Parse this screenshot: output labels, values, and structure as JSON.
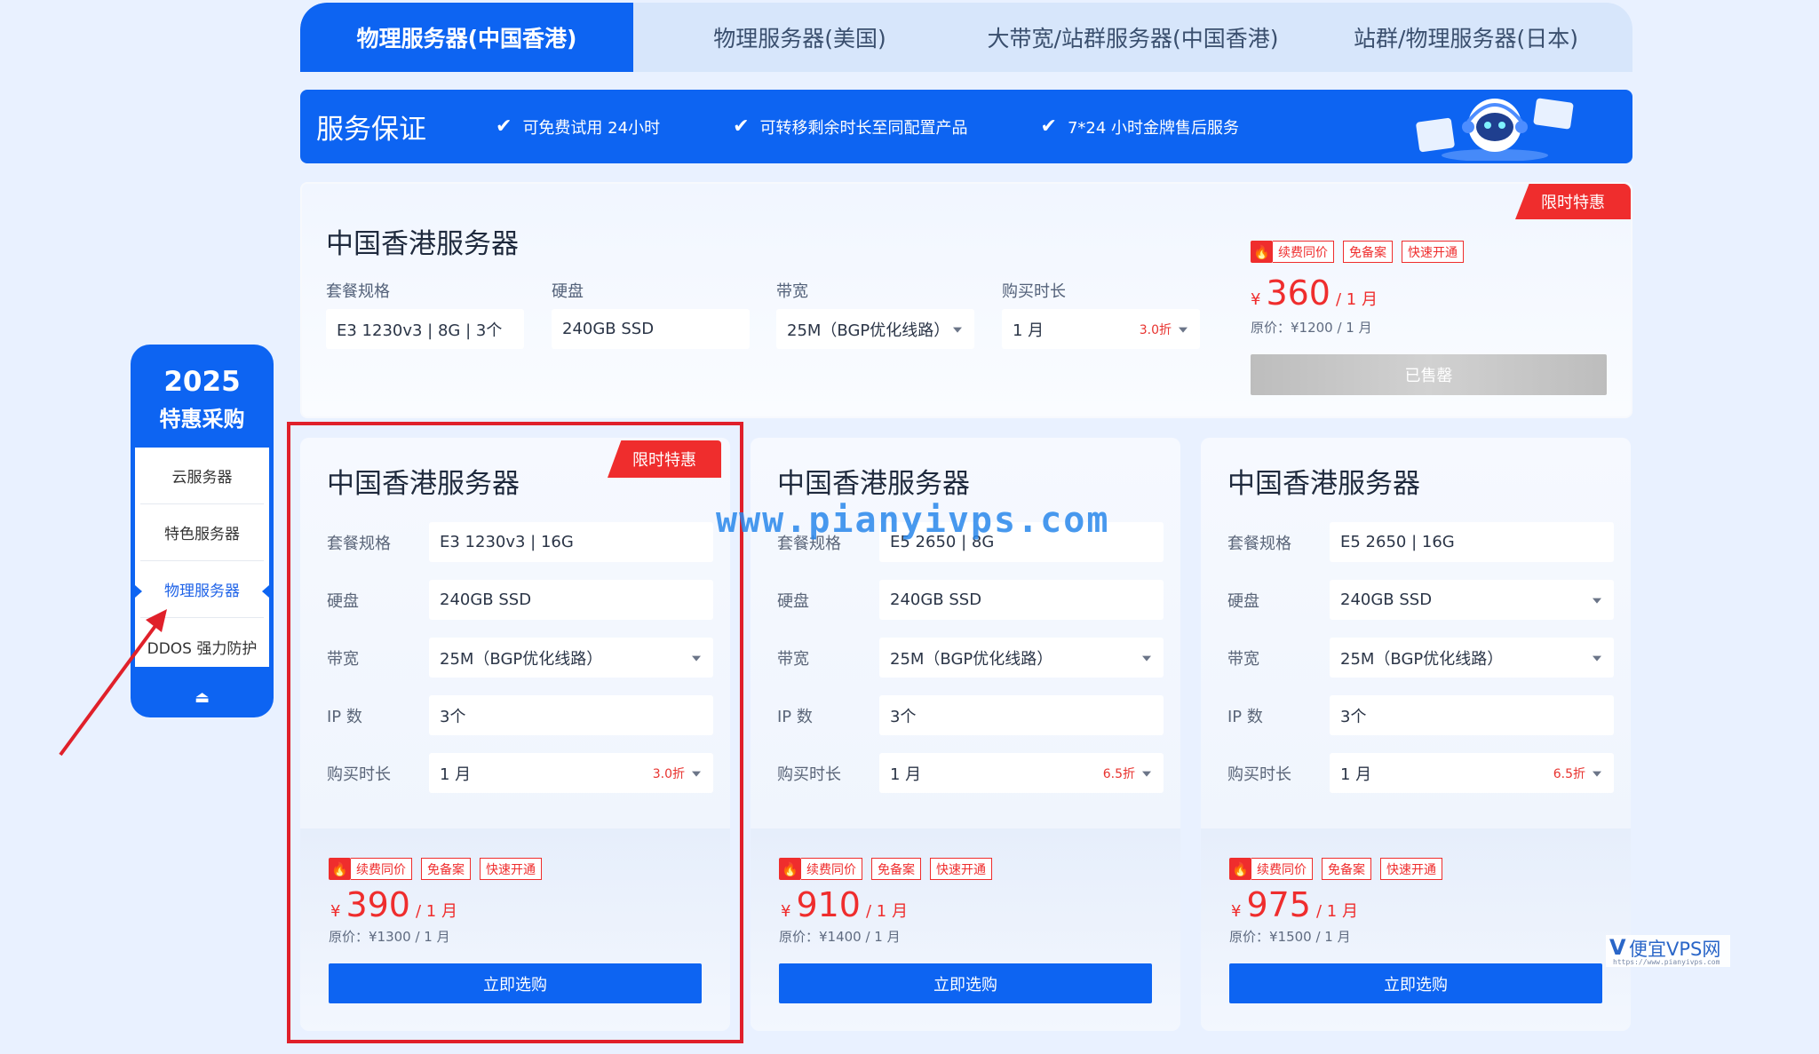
{
  "tabs": [
    {
      "label": "物理服务器(中国香港)",
      "active": true
    },
    {
      "label": "物理服务器(美国)",
      "active": false
    },
    {
      "label": "大带宽/站群服务器(中国香港)",
      "active": false
    },
    {
      "label": "站群/物理服务器(日本)",
      "active": false
    }
  ],
  "guarantee": {
    "title": "服务保证",
    "items": [
      "可免费试用 24小时",
      "可转移剩余时长至同配置产品",
      "7*24 小时金牌售后服务"
    ]
  },
  "wide_card": {
    "ribbon": "限时特惠",
    "title": "中国香港服务器",
    "fields": [
      {
        "label": "套餐规格",
        "value": "E3 1230v3 | 8G | 3个"
      },
      {
        "label": "硬盘",
        "value": "240GB SSD"
      },
      {
        "label": "带宽",
        "value": "25M（BGP优化线路）"
      },
      {
        "label": "购买时长",
        "value": "1 月",
        "discount": "3.0折"
      }
    ],
    "tags": [
      "续费同价",
      "免备案",
      "快速开通"
    ],
    "currency": "¥",
    "price": "360",
    "unit": "/ 1 月",
    "original": "原价：¥1200 / 1 月",
    "button": "已售罄"
  },
  "row_labels": {
    "spec": "套餐规格",
    "disk": "硬盘",
    "bw": "带宽",
    "ip": "IP 数",
    "dur": "购买时长"
  },
  "cards": [
    {
      "ribbon": "限时特惠",
      "title": "中国香港服务器",
      "spec": "E3 1230v3 | 16G",
      "disk": "240GB SSD",
      "bandwidth": "25M（BGP优化线路）",
      "ip": "3个",
      "duration": "1 月",
      "discount": "3.0折",
      "tags": [
        "续费同价",
        "免备案",
        "快速开通"
      ],
      "currency": "¥",
      "price": "390",
      "unit": "/ 1 月",
      "original": "原价：¥1300 / 1 月",
      "button": "立即选购"
    },
    {
      "title": "中国香港服务器",
      "spec": "E5 2650 | 8G",
      "disk": "240GB SSD",
      "bandwidth": "25M（BGP优化线路）",
      "ip": "3个",
      "duration": "1 月",
      "discount": "6.5折",
      "tags": [
        "续费同价",
        "免备案",
        "快速开通"
      ],
      "currency": "¥",
      "price": "910",
      "unit": "/ 1 月",
      "original": "原价：¥1400 / 1 月",
      "button": "立即选购"
    },
    {
      "title": "中国香港服务器",
      "spec": "E5 2650 | 16G",
      "disk": "240GB SSD",
      "bandwidth": "25M（BGP优化线路）",
      "ip": "3个",
      "duration": "1 月",
      "discount": "6.5折",
      "tags": [
        "续费同价",
        "免备案",
        "快速开通"
      ],
      "currency": "¥",
      "price": "975",
      "unit": "/ 1 月",
      "original": "原价：¥1500 / 1 月",
      "button": "立即选购"
    }
  ],
  "promo": {
    "year": "2025",
    "subtitle": "特惠采购",
    "menu": [
      "云服务器",
      "特色服务器",
      "物理服务器",
      "DDOS 强力防护"
    ],
    "active_index": 2
  },
  "watermark": "www.pianyivps.com",
  "logo_watermark": {
    "mark": "V",
    "text": "便宜VPS网",
    "url": "https://www.pianyivps.com"
  },
  "colors": {
    "brand": "#0d64f2",
    "accent": "#ef2d2d",
    "background": "#e9f1ff"
  }
}
